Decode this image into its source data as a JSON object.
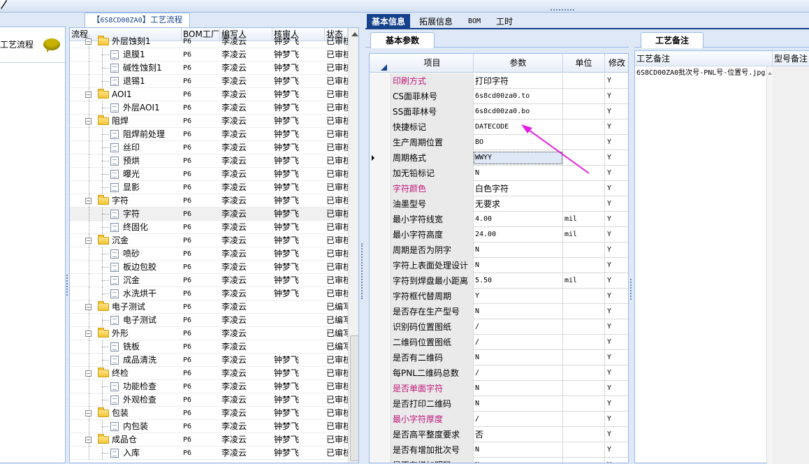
{
  "left_panel": {
    "title": "工艺流程"
  },
  "middle": {
    "tab_code": "6S8CD00ZA0",
    "tab_suffix": "工艺流程",
    "headers": [
      "流程",
      "BOM工厂",
      "编写人",
      "核审人",
      "状态"
    ],
    "rows": [
      {
        "name": "外层蚀刻1",
        "kind": "folder",
        "level": 1,
        "factory": "P6",
        "writer": "李凌云",
        "reviewer": "钟梦飞",
        "status": "已审核"
      },
      {
        "name": "退膜1",
        "kind": "leaf",
        "level": 2,
        "factory": "P6",
        "writer": "李凌云",
        "reviewer": "钟梦飞",
        "status": "已审核"
      },
      {
        "name": "碱性蚀刻1",
        "kind": "leaf",
        "level": 2,
        "factory": "P6",
        "writer": "李凌云",
        "reviewer": "钟梦飞",
        "status": "已审核"
      },
      {
        "name": "退锡1",
        "kind": "leaf",
        "level": 2,
        "factory": "P6",
        "writer": "李凌云",
        "reviewer": "钟梦飞",
        "status": "已审核"
      },
      {
        "name": "AOI1",
        "kind": "folder",
        "level": 1,
        "factory": "P6",
        "writer": "李凌云",
        "reviewer": "钟梦飞",
        "status": "已审核"
      },
      {
        "name": "外层AOI1",
        "kind": "leaf",
        "level": 2,
        "factory": "P6",
        "writer": "李凌云",
        "reviewer": "钟梦飞",
        "status": "已审核"
      },
      {
        "name": "阻焊",
        "kind": "folder",
        "level": 1,
        "factory": "P6",
        "writer": "李凌云",
        "reviewer": "钟梦飞",
        "status": "已审核"
      },
      {
        "name": "阻焊前处理",
        "kind": "leaf",
        "level": 2,
        "factory": "P6",
        "writer": "李凌云",
        "reviewer": "钟梦飞",
        "status": "已审核"
      },
      {
        "name": "丝印",
        "kind": "leaf",
        "level": 2,
        "factory": "P6",
        "writer": "李凌云",
        "reviewer": "钟梦飞",
        "status": "已审核"
      },
      {
        "name": "预烘",
        "kind": "leaf",
        "level": 2,
        "factory": "P6",
        "writer": "李凌云",
        "reviewer": "钟梦飞",
        "status": "已审核"
      },
      {
        "name": "曝光",
        "kind": "leaf",
        "level": 2,
        "factory": "P6",
        "writer": "李凌云",
        "reviewer": "钟梦飞",
        "status": "已审核"
      },
      {
        "name": "显影",
        "kind": "leaf",
        "level": 2,
        "factory": "P6",
        "writer": "李凌云",
        "reviewer": "钟梦飞",
        "status": "已审核"
      },
      {
        "name": "字符",
        "kind": "folder",
        "level": 1,
        "factory": "P6",
        "writer": "李凌云",
        "reviewer": "钟梦飞",
        "status": "已审核"
      },
      {
        "name": "字符",
        "kind": "leaf",
        "level": 2,
        "factory": "P6",
        "writer": "李凌云",
        "reviewer": "钟梦飞",
        "status": "已审核",
        "selected": true
      },
      {
        "name": "终固化",
        "kind": "leaf",
        "level": 2,
        "factory": "P6",
        "writer": "李凌云",
        "reviewer": "钟梦飞",
        "status": "已审核"
      },
      {
        "name": "沉金",
        "kind": "folder",
        "level": 1,
        "factory": "P6",
        "writer": "李凌云",
        "reviewer": "钟梦飞",
        "status": "已审核"
      },
      {
        "name": "喷砂",
        "kind": "leaf",
        "level": 2,
        "factory": "P6",
        "writer": "李凌云",
        "reviewer": "钟梦飞",
        "status": "已审核"
      },
      {
        "name": "板边包胶",
        "kind": "leaf",
        "level": 2,
        "factory": "P6",
        "writer": "李凌云",
        "reviewer": "钟梦飞",
        "status": "已审核"
      },
      {
        "name": "沉金",
        "kind": "leaf",
        "level": 2,
        "factory": "P6",
        "writer": "李凌云",
        "reviewer": "钟梦飞",
        "status": "已审核"
      },
      {
        "name": "水洗烘干",
        "kind": "leaf",
        "level": 2,
        "factory": "P6",
        "writer": "李凌云",
        "reviewer": "钟梦飞",
        "status": "已审核"
      },
      {
        "name": "电子测试",
        "kind": "folder",
        "level": 1,
        "factory": "P6",
        "writer": "李凌云",
        "reviewer": "",
        "status": "已编写"
      },
      {
        "name": "电子测试",
        "kind": "leaf",
        "level": 2,
        "factory": "P6",
        "writer": "李凌云",
        "reviewer": "",
        "status": "已编写"
      },
      {
        "name": "外形",
        "kind": "folder",
        "level": 1,
        "factory": "P6",
        "writer": "李凌云",
        "reviewer": "",
        "status": "已编写"
      },
      {
        "name": "铣板",
        "kind": "leaf",
        "level": 2,
        "factory": "P6",
        "writer": "李凌云",
        "reviewer": "",
        "status": "已编写"
      },
      {
        "name": "成品清洗",
        "kind": "leaf",
        "level": 2,
        "factory": "P6",
        "writer": "李凌云",
        "reviewer": "钟梦飞",
        "status": "已审核"
      },
      {
        "name": "终检",
        "kind": "folder",
        "level": 1,
        "factory": "P6",
        "writer": "李凌云",
        "reviewer": "钟梦飞",
        "status": "已审核"
      },
      {
        "name": "功能检查",
        "kind": "leaf",
        "level": 2,
        "factory": "P6",
        "writer": "李凌云",
        "reviewer": "钟梦飞",
        "status": "已审核"
      },
      {
        "name": "外观检查",
        "kind": "leaf",
        "level": 2,
        "factory": "P6",
        "writer": "李凌云",
        "reviewer": "钟梦飞",
        "status": "已审核"
      },
      {
        "name": "包装",
        "kind": "folder",
        "level": 1,
        "factory": "P6",
        "writer": "李凌云",
        "reviewer": "钟梦飞",
        "status": "已审核"
      },
      {
        "name": "内包装",
        "kind": "leaf",
        "level": 2,
        "factory": "P6",
        "writer": "李凌云",
        "reviewer": "钟梦飞",
        "status": "已审核"
      },
      {
        "name": "成品仓",
        "kind": "folder",
        "level": 1,
        "factory": "P6",
        "writer": "李凌云",
        "reviewer": "钟梦飞",
        "status": "已审核"
      },
      {
        "name": "入库",
        "kind": "leaf",
        "level": 2,
        "factory": "P6",
        "writer": "李凌云",
        "reviewer": "钟梦飞",
        "status": "已审核"
      }
    ]
  },
  "tabs": [
    "基本信息",
    "拓展信息",
    "BOM",
    "工时"
  ],
  "subtab": "基本参数",
  "params": {
    "headers": [
      "项目",
      "参数",
      "单位",
      "修改"
    ],
    "rows": [
      {
        "name": "印刷方式",
        "value": "打印字符",
        "unit": "",
        "mod": "Y",
        "highlight": true,
        "cjk": true
      },
      {
        "name": "CS面菲林号",
        "value": "6s8cd00za0.to",
        "unit": "",
        "mod": "Y"
      },
      {
        "name": "SS面菲林号",
        "value": "6s8cd00za0.bo",
        "unit": "",
        "mod": "Y"
      },
      {
        "name": "快捷标记",
        "value": "DATECODE",
        "unit": "",
        "mod": "Y"
      },
      {
        "name": "生产周期位置",
        "value": "BO",
        "unit": "",
        "mod": "Y"
      },
      {
        "name": "周期格式",
        "value": "WWYY",
        "unit": "",
        "mod": "Y",
        "current": true
      },
      {
        "name": "加无铅标记",
        "value": "N",
        "unit": "",
        "mod": "Y"
      },
      {
        "name": "字符颜色",
        "value": "白色字符",
        "unit": "",
        "mod": "Y",
        "highlight": true,
        "cjk": true
      },
      {
        "name": "油墨型号",
        "value": "无要求",
        "unit": "",
        "mod": "Y",
        "cjk": true
      },
      {
        "name": "最小字符线宽",
        "value": "4.00",
        "unit": "mil",
        "mod": "Y"
      },
      {
        "name": "最小字符高度",
        "value": "24.00",
        "unit": "mil",
        "mod": "Y"
      },
      {
        "name": "周期是否为阴字",
        "value": "N",
        "unit": "",
        "mod": "Y"
      },
      {
        "name": "字符上表面处理设计",
        "value": "N",
        "unit": "",
        "mod": "Y"
      },
      {
        "name": "字符到焊盘最小距离",
        "value": "5.50",
        "unit": "mil",
        "mod": "Y"
      },
      {
        "name": "字符框代替周期",
        "value": "Y",
        "unit": "",
        "mod": "Y"
      },
      {
        "name": "是否存在生产型号",
        "value": "N",
        "unit": "",
        "mod": "Y"
      },
      {
        "name": "识别码位置图纸",
        "value": "/",
        "unit": "",
        "mod": "Y"
      },
      {
        "name": "二维码位置图纸",
        "value": "/",
        "unit": "",
        "mod": "Y"
      },
      {
        "name": "是否有二维码",
        "value": "N",
        "unit": "",
        "mod": "Y"
      },
      {
        "name": "每PNL二维码总数",
        "value": "/",
        "unit": "",
        "mod": "Y"
      },
      {
        "name": "是否单面字符",
        "value": "N",
        "unit": "",
        "mod": "Y",
        "highlight": true
      },
      {
        "name": "是否打印二维码",
        "value": "N",
        "unit": "",
        "mod": "Y"
      },
      {
        "name": "最小字符厚度",
        "value": "/",
        "unit": "",
        "mod": "Y",
        "highlight": true
      },
      {
        "name": "是否高平整度要求",
        "value": "否",
        "unit": "",
        "mod": "Y",
        "cjk": true
      },
      {
        "name": "是否有增加批次号",
        "value": "N",
        "unit": "",
        "mod": "Y"
      },
      {
        "name": "是否有增加明码",
        "value": "N",
        "unit": "",
        "mod": "Y"
      }
    ]
  },
  "notes": {
    "tab": "工艺备注",
    "headers": [
      "工艺备注",
      "型号备注"
    ],
    "text": "6S8CD00ZA0批次号-PNL号-位置号.jpg"
  },
  "colors": {
    "accent": "#15428b",
    "highlight_text": "#c0187a",
    "annotation_arrow": "#e020e0"
  }
}
